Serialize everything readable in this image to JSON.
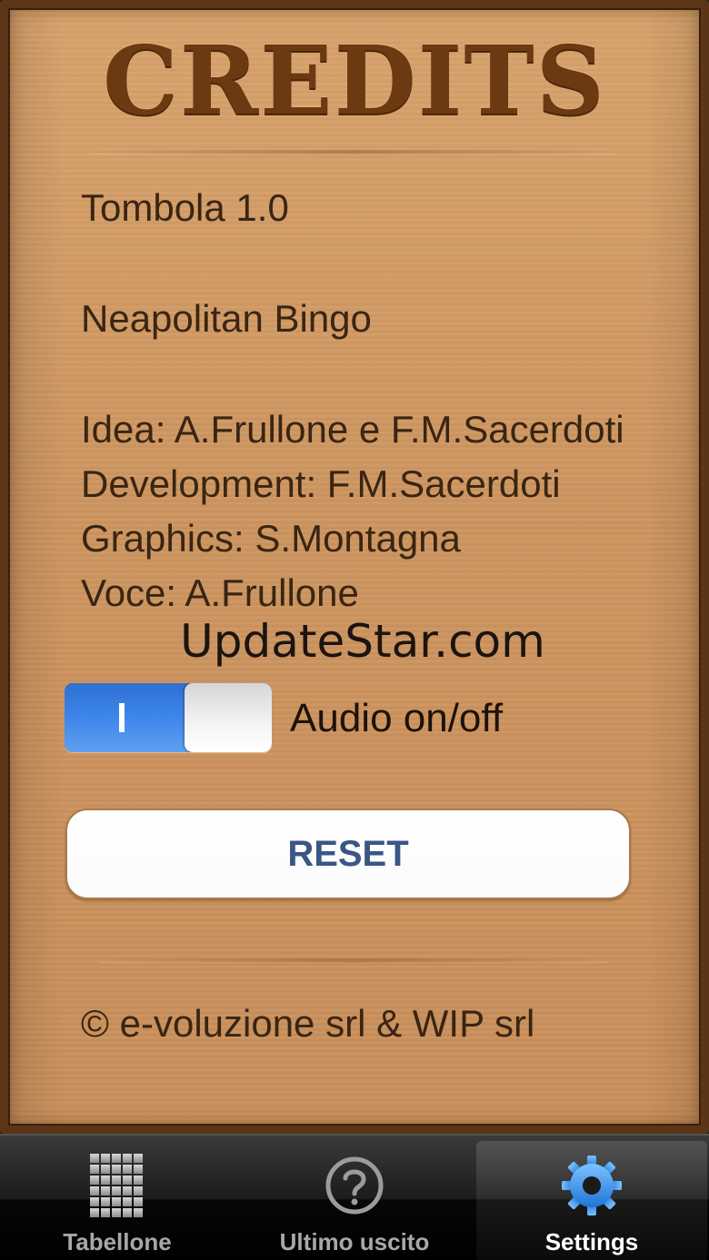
{
  "credits": {
    "title": "CREDITS",
    "app_version": "Tombola 1.0",
    "subtitle": "Neapolitan Bingo",
    "lines": [
      "Idea: A.Frullone e F.M.Sacerdoti",
      "Development: F.M.Sacerdoti",
      "Graphics: S.Montagna",
      "Voce: A.Frullone"
    ],
    "copyright": "© e-voluzione srl & WIP srl"
  },
  "watermark": "UpdateStar.com",
  "audio_switch": {
    "label": "Audio on/off",
    "state": "on",
    "on_glyph": "I"
  },
  "reset_button": {
    "label": "RESET"
  },
  "tabbar": {
    "tabs": [
      {
        "label": "Tabellone",
        "icon": "grid-icon",
        "active": false
      },
      {
        "label": "Ultimo uscito",
        "icon": "question-icon",
        "active": false
      },
      {
        "label": "Settings",
        "icon": "gear-icon",
        "active": true
      }
    ]
  },
  "colors": {
    "cardboard": "#cd9560",
    "frame": "#5c3517",
    "title": "#6b3a12",
    "switch_on": "#3e86ea",
    "reset_text": "#3a5686",
    "active_icon": "#2a8ee8"
  }
}
